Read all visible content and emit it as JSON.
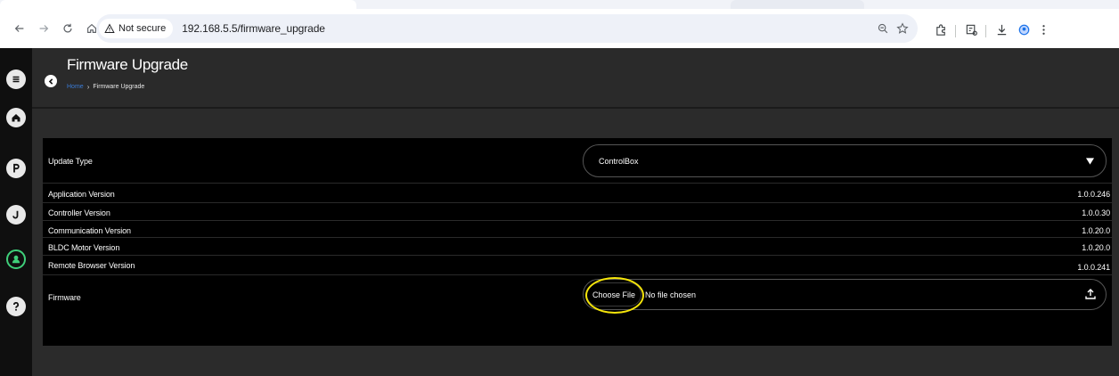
{
  "browser": {
    "security_label": "Not secure",
    "url": "192.168.5.5/firmware_upgrade"
  },
  "icons": {
    "browser": [
      "back-arrow-icon",
      "forward-arrow-icon",
      "reload-icon",
      "home-icon",
      "warning-triangle-icon",
      "zoom-icon",
      "bookmark-star-icon",
      "extensions-puzzle-icon",
      "reading-list-icon",
      "download-icon",
      "profile-icon",
      "more-menu-icon"
    ],
    "sidebar": [
      "menu-icon",
      "home-icon",
      "p-icon",
      "j-icon",
      "user-icon",
      "help-icon"
    ],
    "page": [
      "back-chevron-icon",
      "dropdown-arrow-icon",
      "upload-icon"
    ]
  },
  "colors": {
    "sidebar_active": "#3fcf7a",
    "breadcrumb_link": "#3a7bd5",
    "highlight_ring": "#f5e50a"
  },
  "header": {
    "title": "Firmware Upgrade",
    "breadcrumb_home": "Home",
    "breadcrumb_separator": "›",
    "breadcrumb_current": "Firmware Upgrade"
  },
  "update_type": {
    "label": "Update Type",
    "selected": "ControlBox"
  },
  "versions": [
    {
      "label": "Application Version",
      "value": "1.0.0.246"
    },
    {
      "label": "Controller Version",
      "value": "1.0.0.30"
    },
    {
      "label": "Communication Version",
      "value": "1.0.20.0"
    },
    {
      "label": "BLDC Motor Version",
      "value": "1.0.20.0"
    },
    {
      "label": "Remote Browser Version",
      "value": "1.0.0.241"
    }
  ],
  "firmware": {
    "label": "Firmware",
    "choose_button": "Choose File",
    "status": "No file chosen"
  }
}
